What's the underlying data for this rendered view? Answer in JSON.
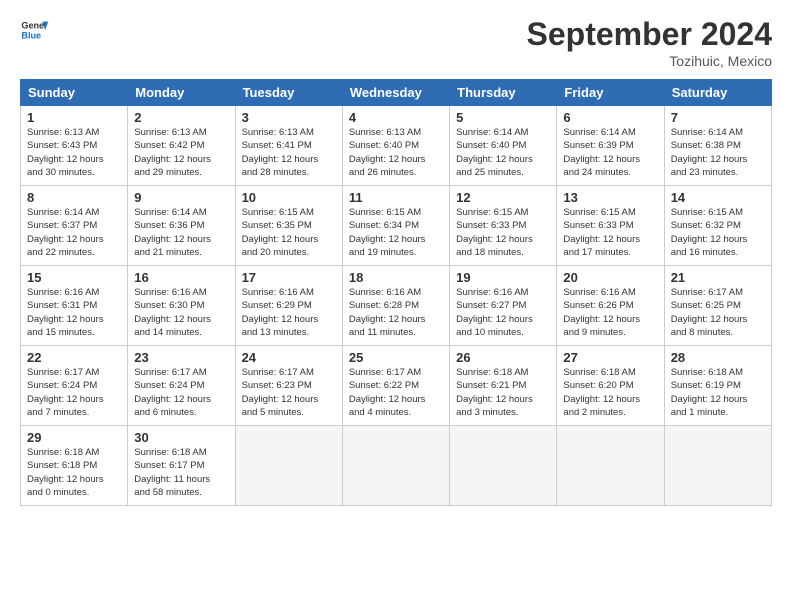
{
  "logo": {
    "line1": "General",
    "line2": "Blue"
  },
  "title": "September 2024",
  "location": "Tozihuic, Mexico",
  "headers": [
    "Sunday",
    "Monday",
    "Tuesday",
    "Wednesday",
    "Thursday",
    "Friday",
    "Saturday"
  ],
  "rows": [
    [
      {
        "day": "1",
        "info": "Sunrise: 6:13 AM\nSunset: 6:43 PM\nDaylight: 12 hours\nand 30 minutes."
      },
      {
        "day": "2",
        "info": "Sunrise: 6:13 AM\nSunset: 6:42 PM\nDaylight: 12 hours\nand 29 minutes."
      },
      {
        "day": "3",
        "info": "Sunrise: 6:13 AM\nSunset: 6:41 PM\nDaylight: 12 hours\nand 28 minutes."
      },
      {
        "day": "4",
        "info": "Sunrise: 6:13 AM\nSunset: 6:40 PM\nDaylight: 12 hours\nand 26 minutes."
      },
      {
        "day": "5",
        "info": "Sunrise: 6:14 AM\nSunset: 6:40 PM\nDaylight: 12 hours\nand 25 minutes."
      },
      {
        "day": "6",
        "info": "Sunrise: 6:14 AM\nSunset: 6:39 PM\nDaylight: 12 hours\nand 24 minutes."
      },
      {
        "day": "7",
        "info": "Sunrise: 6:14 AM\nSunset: 6:38 PM\nDaylight: 12 hours\nand 23 minutes."
      }
    ],
    [
      {
        "day": "8",
        "info": "Sunrise: 6:14 AM\nSunset: 6:37 PM\nDaylight: 12 hours\nand 22 minutes."
      },
      {
        "day": "9",
        "info": "Sunrise: 6:14 AM\nSunset: 6:36 PM\nDaylight: 12 hours\nand 21 minutes."
      },
      {
        "day": "10",
        "info": "Sunrise: 6:15 AM\nSunset: 6:35 PM\nDaylight: 12 hours\nand 20 minutes."
      },
      {
        "day": "11",
        "info": "Sunrise: 6:15 AM\nSunset: 6:34 PM\nDaylight: 12 hours\nand 19 minutes."
      },
      {
        "day": "12",
        "info": "Sunrise: 6:15 AM\nSunset: 6:33 PM\nDaylight: 12 hours\nand 18 minutes."
      },
      {
        "day": "13",
        "info": "Sunrise: 6:15 AM\nSunset: 6:33 PM\nDaylight: 12 hours\nand 17 minutes."
      },
      {
        "day": "14",
        "info": "Sunrise: 6:15 AM\nSunset: 6:32 PM\nDaylight: 12 hours\nand 16 minutes."
      }
    ],
    [
      {
        "day": "15",
        "info": "Sunrise: 6:16 AM\nSunset: 6:31 PM\nDaylight: 12 hours\nand 15 minutes."
      },
      {
        "day": "16",
        "info": "Sunrise: 6:16 AM\nSunset: 6:30 PM\nDaylight: 12 hours\nand 14 minutes."
      },
      {
        "day": "17",
        "info": "Sunrise: 6:16 AM\nSunset: 6:29 PM\nDaylight: 12 hours\nand 13 minutes."
      },
      {
        "day": "18",
        "info": "Sunrise: 6:16 AM\nSunset: 6:28 PM\nDaylight: 12 hours\nand 11 minutes."
      },
      {
        "day": "19",
        "info": "Sunrise: 6:16 AM\nSunset: 6:27 PM\nDaylight: 12 hours\nand 10 minutes."
      },
      {
        "day": "20",
        "info": "Sunrise: 6:16 AM\nSunset: 6:26 PM\nDaylight: 12 hours\nand 9 minutes."
      },
      {
        "day": "21",
        "info": "Sunrise: 6:17 AM\nSunset: 6:25 PM\nDaylight: 12 hours\nand 8 minutes."
      }
    ],
    [
      {
        "day": "22",
        "info": "Sunrise: 6:17 AM\nSunset: 6:24 PM\nDaylight: 12 hours\nand 7 minutes."
      },
      {
        "day": "23",
        "info": "Sunrise: 6:17 AM\nSunset: 6:24 PM\nDaylight: 12 hours\nand 6 minutes."
      },
      {
        "day": "24",
        "info": "Sunrise: 6:17 AM\nSunset: 6:23 PM\nDaylight: 12 hours\nand 5 minutes."
      },
      {
        "day": "25",
        "info": "Sunrise: 6:17 AM\nSunset: 6:22 PM\nDaylight: 12 hours\nand 4 minutes."
      },
      {
        "day": "26",
        "info": "Sunrise: 6:18 AM\nSunset: 6:21 PM\nDaylight: 12 hours\nand 3 minutes."
      },
      {
        "day": "27",
        "info": "Sunrise: 6:18 AM\nSunset: 6:20 PM\nDaylight: 12 hours\nand 2 minutes."
      },
      {
        "day": "28",
        "info": "Sunrise: 6:18 AM\nSunset: 6:19 PM\nDaylight: 12 hours\nand 1 minute."
      }
    ],
    [
      {
        "day": "29",
        "info": "Sunrise: 6:18 AM\nSunset: 6:18 PM\nDaylight: 12 hours\nand 0 minutes."
      },
      {
        "day": "30",
        "info": "Sunrise: 6:18 AM\nSunset: 6:17 PM\nDaylight: 11 hours\nand 58 minutes."
      },
      {
        "day": "",
        "info": ""
      },
      {
        "day": "",
        "info": ""
      },
      {
        "day": "",
        "info": ""
      },
      {
        "day": "",
        "info": ""
      },
      {
        "day": "",
        "info": ""
      }
    ]
  ]
}
